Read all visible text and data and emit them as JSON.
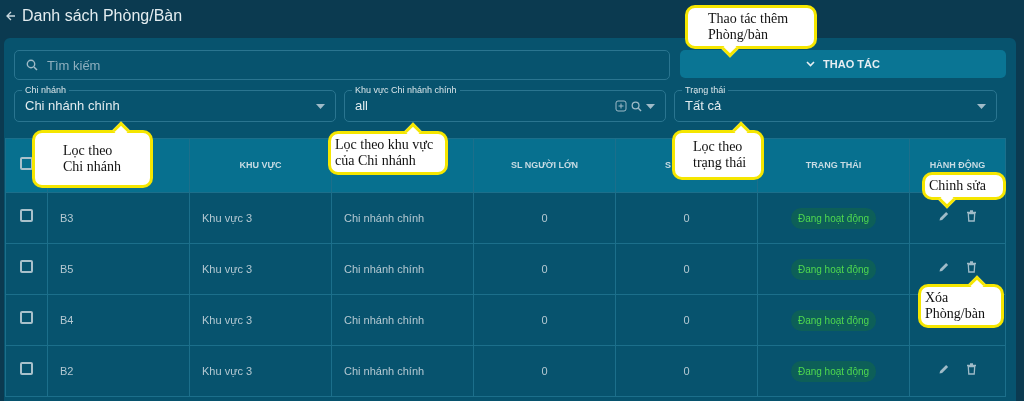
{
  "header": {
    "title": "Danh sách Phòng/Bàn"
  },
  "search": {
    "placeholder": "Tìm kiếm"
  },
  "action_button": {
    "label": "THAO TÁC"
  },
  "filters": [
    {
      "kind": "select",
      "label": "Chi nhánh",
      "value": "Chi nhánh chính"
    },
    {
      "kind": "autocomplete",
      "label": "Khu vực Chi nhánh chính",
      "value": "all"
    },
    {
      "kind": "select",
      "label": "Trạng thái",
      "value": "Tất cả"
    }
  ],
  "table": {
    "header_checkbox": {
      "checked": false
    },
    "columns": [
      {
        "kind": "blank"
      },
      {
        "kind": "text",
        "label": "KHU VỰC"
      },
      {
        "kind": "blank"
      },
      {
        "kind": "text",
        "label": "SL NGƯỜI LỚN"
      },
      {
        "kind": "text",
        "label": "S"
      },
      {
        "kind": "text",
        "label": "TRẠNG THÁI"
      },
      {
        "kind": "text",
        "label": "HÀNH ĐỘNG"
      }
    ],
    "rows": [
      {
        "checked": false,
        "name": "B3",
        "area": "Khu vực 3",
        "branch": "Chi nhánh chính",
        "adults": "0",
        "children": "0",
        "status": "Đang hoạt động",
        "show_actions": true
      },
      {
        "checked": false,
        "name": "B5",
        "area": "Khu vực 3",
        "branch": "Chi nhánh chính",
        "adults": "0",
        "children": "0",
        "status": "Đang hoạt động",
        "show_actions": true
      },
      {
        "checked": false,
        "name": "B4",
        "area": "Khu vực 3",
        "branch": "Chi nhánh chính",
        "adults": "0",
        "children": "0",
        "status": "Đang hoạt động",
        "show_actions": false
      },
      {
        "checked": false,
        "name": "B2",
        "area": "Khu vực 3",
        "branch": "Chi nhánh chính",
        "adults": "0",
        "children": "0",
        "status": "Đang hoạt động",
        "show_actions": true
      }
    ]
  },
  "callouts": [
    {
      "text": "Thao tác thêm Phòng/bàn"
    },
    {
      "text": "Lọc theo Chi nhánh"
    },
    {
      "text": "Lọc theo khu vực của Chi nhánh"
    },
    {
      "text": "Lọc theo trạng thái"
    },
    {
      "text": "Chinh sửa"
    },
    {
      "text": "Xóa Phòng/bàn"
    }
  ]
}
